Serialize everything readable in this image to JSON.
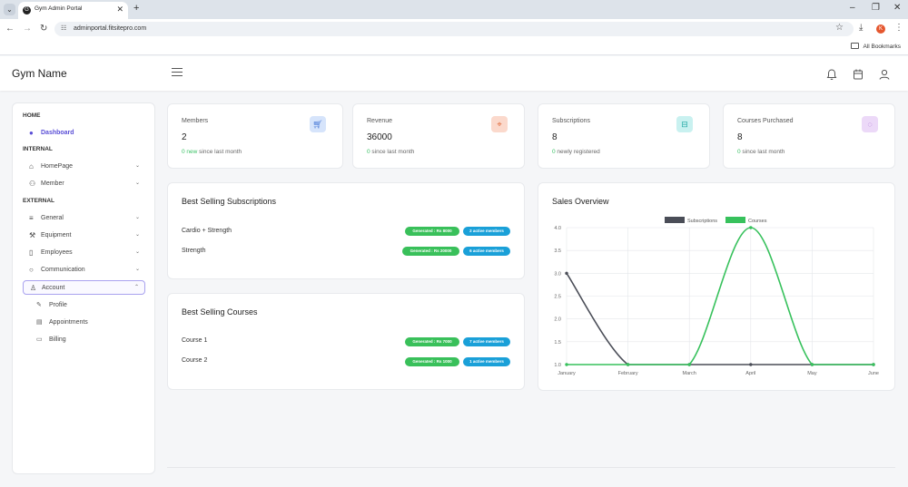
{
  "browser": {
    "tab_title": "Gym Admin Portal",
    "tab_favicon": "G",
    "url": "adminportal.fitsitepro.com",
    "profile_initial": "K",
    "bookmarks_label": "All Bookmarks"
  },
  "header": {
    "brand": "Gym Name"
  },
  "sidebar": {
    "sections": {
      "home": "HOME",
      "internal": "INTERNAL",
      "external": "EXTERNAL"
    },
    "items": {
      "dashboard": "Dashboard",
      "homepage": "HomePage",
      "member": "Member",
      "general": "General",
      "equipment": "Equipment",
      "employees": "Employees",
      "communication": "Communication",
      "account": "Account"
    },
    "sub_items": {
      "profile": "Profile",
      "appointments": "Appointments",
      "billing": "Billing"
    }
  },
  "stats": [
    {
      "label": "Members",
      "value": "2",
      "highlight": "0 new",
      "rest": " since last month",
      "icon": "cart-icon",
      "color": "#d6e4fb"
    },
    {
      "label": "Revenue",
      "value": "36000",
      "highlight": "0",
      "rest": " since last month",
      "icon": "location-pin-icon",
      "color": "#fbd9cc"
    },
    {
      "label": "Subscriptions",
      "value": "8",
      "highlight": "0",
      "rest": " newly registered",
      "icon": "inbox-icon",
      "color": "#c9f1f0"
    },
    {
      "label": "Courses Purchased",
      "value": "8",
      "highlight": "0",
      "rest": " since last month",
      "icon": "chat-bubble-icon",
      "color": "#ecd9f8"
    }
  ],
  "best_subscriptions": {
    "title": "Best Selling Subscriptions",
    "rows": [
      {
        "name": "Cardio + Strength",
        "generated": "Generated : Rs 8000",
        "members": "2 active members"
      },
      {
        "name": "Strength",
        "generated": "Generated : Rs 20000",
        "members": "6 active members"
      }
    ]
  },
  "best_courses": {
    "title": "Best Selling Courses",
    "rows": [
      {
        "name": "Course 1",
        "generated": "Generated : Rs 7000",
        "members": "7 active members"
      },
      {
        "name": "Course 2",
        "generated": "Generated : Rs 1000",
        "members": "1 active members"
      }
    ]
  },
  "sales": {
    "title": "Sales Overview"
  },
  "chart_data": {
    "type": "line",
    "title": "Sales Overview",
    "categories": [
      "January",
      "February",
      "March",
      "April",
      "May",
      "June"
    ],
    "ylim": [
      1.0,
      4.0
    ],
    "yticks": [
      "1.0",
      "1.5",
      "2.0",
      "2.5",
      "3.0",
      "3.5",
      "4.0"
    ],
    "grid": true,
    "legend": "top-center",
    "series": [
      {
        "name": "Subscriptions",
        "values": [
          3,
          1,
          1,
          1,
          1,
          1
        ],
        "color": "#4a4d57"
      },
      {
        "name": "Courses",
        "values": [
          1,
          1,
          1,
          4,
          1,
          1
        ],
        "color": "#37c15c"
      }
    ]
  }
}
